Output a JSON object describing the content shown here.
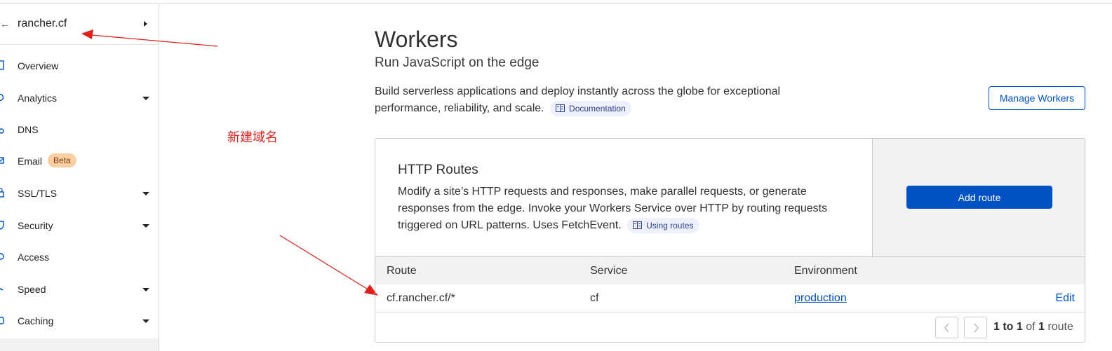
{
  "sidebar": {
    "zone": {
      "back_icon": "back-arrow-icon",
      "name": "rancher.cf",
      "expand_icon": "caret-right-icon"
    },
    "items": [
      {
        "label": "Overview",
        "icon": "document-icon",
        "has_caret": false
      },
      {
        "label": "Analytics",
        "icon": "analytics-icon",
        "has_caret": true
      },
      {
        "label": "DNS",
        "icon": "dns-icon",
        "has_caret": false
      },
      {
        "label": "Email",
        "icon": "email-icon",
        "has_caret": false,
        "badge": "Beta"
      },
      {
        "label": "SSL/TLS",
        "icon": "lock-icon",
        "has_caret": true
      },
      {
        "label": "Security",
        "icon": "shield-icon",
        "has_caret": true
      },
      {
        "label": "Access",
        "icon": "access-icon",
        "has_caret": false
      },
      {
        "label": "Speed",
        "icon": "speed-icon",
        "has_caret": true
      },
      {
        "label": "Caching",
        "icon": "caching-icon",
        "has_caret": true
      }
    ]
  },
  "annotation": {
    "text": "新建域名",
    "color": "#e0201b"
  },
  "header": {
    "title": "Workers",
    "subtitle": "Run JavaScript on the edge",
    "description": "Build serverless applications and deploy instantly across the globe for exceptional performance, reliability, and scale.",
    "doc_link": "Documentation",
    "manage_button": "Manage Workers"
  },
  "routes_card": {
    "title": "HTTP Routes",
    "description": "Modify a site’s HTTP requests and responses, make parallel requests, or generate responses from the edge. Invoke your Workers Service over HTTP by routing requests triggered on URL patterns. Uses FetchEvent.",
    "doc_link": "Using routes",
    "add_button": "Add route",
    "columns": [
      "Route",
      "Service",
      "Environment"
    ],
    "rows": [
      {
        "route": "cf.rancher.cf/*",
        "service": "cf",
        "environment": "production",
        "action": "Edit"
      }
    ],
    "pagination": {
      "range": "1 to 1",
      "of": "of",
      "total": "1",
      "unit": "route"
    }
  },
  "colors": {
    "accent": "#0051c3",
    "badge_bg": "#fbcfa4",
    "annotation": "#e0201b"
  }
}
